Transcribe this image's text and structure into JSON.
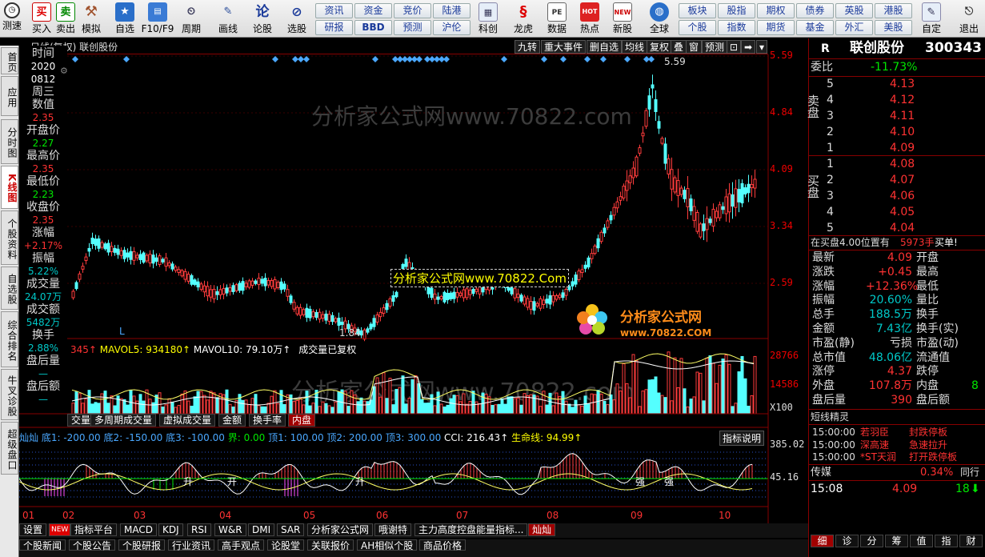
{
  "toolbar": {
    "items": [
      {
        "label": "测速",
        "icon": "clock-icon"
      },
      {
        "label": "买入",
        "icon": "buy-icon",
        "glyph": "买"
      },
      {
        "label": "卖出",
        "icon": "sell-icon",
        "glyph": "卖"
      },
      {
        "label": "模拟",
        "icon": "hammer-icon"
      },
      {
        "label": "自选",
        "icon": "star-icon"
      },
      {
        "label": "F10/F9",
        "icon": "f10-icon"
      },
      {
        "label": "周期",
        "icon": "period-icon"
      },
      {
        "label": "画线",
        "icon": "pen-icon"
      },
      {
        "label": "论股",
        "icon": "discuss-icon",
        "glyph": "论"
      },
      {
        "label": "选股",
        "icon": "stock-pick-icon"
      },
      {
        "label": "科创",
        "icon": "star-market-icon"
      },
      {
        "label": "龙虎",
        "icon": "dragon-tiger-icon"
      },
      {
        "label": "数据",
        "icon": "pe-icon",
        "glyph": "PE"
      },
      {
        "label": "热点",
        "icon": "hot-icon",
        "glyph": "HOT"
      },
      {
        "label": "新股",
        "icon": "newstock-icon",
        "glyph": "NEW"
      },
      {
        "label": "全球",
        "icon": "globe-icon"
      },
      {
        "label": "自定",
        "icon": "custom-icon"
      },
      {
        "label": "退出",
        "icon": "exit-icon"
      }
    ],
    "small_row1": [
      "资讯",
      "资金",
      "竞价",
      "陆港"
    ],
    "small_row2": [
      "研报",
      "BBD",
      "预测",
      "沪伦"
    ],
    "small_row3": [
      "板块",
      "股指",
      "期权",
      "债券",
      "英股",
      "港股"
    ],
    "small_row4": [
      "个股",
      "指数",
      "期货",
      "基金",
      "外汇",
      "美股"
    ]
  },
  "left_tabs": [
    "首页",
    "应用",
    "分时图",
    "K线图",
    "个股资料",
    "自选股",
    "综合排名",
    "牛叉诊股",
    "超级盘口"
  ],
  "chart_header": {
    "title": "日线(复权)  联创股份",
    "buttons": [
      "九转",
      "重大事件",
      "删自选",
      "均线",
      "复权",
      "叠",
      "窗",
      "预测"
    ]
  },
  "info_panel": [
    {
      "label": "时间",
      "value": "2020",
      "color": "wht"
    },
    {
      "label": "",
      "value": "0812",
      "color": "wht"
    },
    {
      "label": "周三",
      "value": "",
      "color": "wht"
    },
    {
      "label": "数值",
      "value": "2.35",
      "color": "red"
    },
    {
      "label": "开盘价",
      "value": "2.27",
      "color": "grn"
    },
    {
      "label": "最高价",
      "value": "2.35",
      "color": "red"
    },
    {
      "label": "最低价",
      "value": "2.23",
      "color": "grn"
    },
    {
      "label": "收盘价",
      "value": "2.35",
      "color": "red"
    },
    {
      "label": "涨幅",
      "value": "+2.17%",
      "color": "red"
    },
    {
      "label": "振幅",
      "value": "5.22%",
      "color": "cyan"
    },
    {
      "label": "成交量",
      "value": "24.07万",
      "color": "cyan"
    },
    {
      "label": "成交额",
      "value": "5482万",
      "color": "cyan"
    },
    {
      "label": "换手",
      "value": "2.88%",
      "color": "cyan"
    },
    {
      "label": "盘后量",
      "value": "—",
      "color": "cyan"
    },
    {
      "label": "盘后额",
      "value": "—",
      "color": "cyan"
    }
  ],
  "price_axis": [
    "5.59",
    "4.84",
    "4.09",
    "3.34",
    "2.59"
  ],
  "vol_axis": [
    "28766",
    "14586",
    "X100"
  ],
  "ind_axis": [
    "385.02",
    "45.16"
  ],
  "time_axis": [
    "01",
    "02",
    "03",
    "04",
    "05",
    "06",
    "07",
    "08",
    "09",
    "10"
  ],
  "kline": {
    "max_label": "5.59",
    "min_label": "1.84",
    "watermark": "分析家公式网www.70822.com",
    "watermark_box": "分析家公式网www.70822.Com",
    "logo_text": "分析家公式网",
    "logo_url": "www.70822.COM",
    "lmarks": [
      "L",
      "L"
    ]
  },
  "volume_header": {
    "prefix": "345↑",
    "mavol5": "MAVOL5: 934180↑",
    "mavol10": "MAVOL10: 79.10万↑",
    "note": "成交量已复权"
  },
  "volume_tabs": [
    "交量",
    "多周期成交量",
    "虚拟成交量",
    "金额",
    "换手率",
    "内盘"
  ],
  "indicator_header": {
    "name": "灿灿",
    "items": "底1: -200.00  底2: -150.00  底3: -100.00",
    "jie": "界: 0.00",
    "tops": "顶1: 100.00  顶2: 200.00  顶3: 300.00",
    "cci": "CCI: 216.43↑",
    "life": "生命线: 94.99↑",
    "help": "指标说明"
  },
  "indicator_marks": [
    "升",
    "开",
    "升",
    "强",
    "强"
  ],
  "bottom_tabs": [
    "设置",
    "NEW",
    "指标平台",
    "MACD",
    "KDJ",
    "RSI",
    "W&R",
    "DMI",
    "SAR",
    "分析家公式网",
    "哦谢特",
    "主力高度控盘能量指标...",
    "灿灿"
  ],
  "bottom_tabs2": [
    "个股新闻",
    "个股公告",
    "个股研报",
    "行业资讯",
    "高手观点",
    "论股堂",
    "关联报价",
    "AH相似个股",
    "商品价格"
  ],
  "quote": {
    "code_letter": "R",
    "name": "联创股份",
    "code": "300343",
    "weibi_label": "委比",
    "weibi": "-11.73%",
    "sell_label": "卖盘",
    "buy_label": "买盘",
    "sell": [
      [
        "5",
        "4.13"
      ],
      [
        "4",
        "4.12"
      ],
      [
        "3",
        "4.11"
      ],
      [
        "2",
        "4.10"
      ],
      [
        "1",
        "4.09"
      ]
    ],
    "buy": [
      [
        "1",
        "4.08"
      ],
      [
        "2",
        "4.07"
      ],
      [
        "3",
        "4.06"
      ],
      [
        "4",
        "4.05"
      ],
      [
        "5",
        "4.04"
      ]
    ],
    "pending": "在买盘4.00位置有",
    "pending_vol": "5973手",
    "pending_tail": "买单!",
    "stats": [
      [
        "最新",
        "4.09",
        "开盘",
        ""
      ],
      [
        "涨跌",
        "+0.45",
        "最高",
        ""
      ],
      [
        "涨幅",
        "+12.36%",
        "最低",
        ""
      ],
      [
        "振幅",
        "20.60%",
        "量比",
        ""
      ],
      [
        "总手",
        "188.5万",
        "换手",
        ""
      ],
      [
        "金额",
        "7.43亿",
        "换手(实)",
        ""
      ],
      [
        "市盈(静)",
        "亏损",
        "市盈(动)",
        ""
      ],
      [
        "总市值",
        "48.06亿",
        "流通值",
        ""
      ],
      [
        "涨停",
        "4.37",
        "跌停",
        ""
      ],
      [
        "外盘",
        "107.8万",
        "内盘",
        "8"
      ],
      [
        "盘后量",
        "390",
        "盘后额",
        ""
      ]
    ],
    "elf_title": "短线精灵",
    "elf": [
      [
        "15:00:00",
        "若羽臣",
        "封跌停板"
      ],
      [
        "15:00:00",
        "深高速",
        "急速拉升"
      ],
      [
        "15:00:00",
        "*ST天润",
        "打开跌停板"
      ]
    ],
    "media_label": "传媒",
    "media_pct": "0.34%",
    "media_tail": "同行",
    "last_time": "15:08",
    "last_price": "4.09",
    "last_vol": "18",
    "bottom_tabs": [
      "细",
      "诊",
      "分",
      "筹",
      "值",
      "指",
      "财"
    ]
  }
}
